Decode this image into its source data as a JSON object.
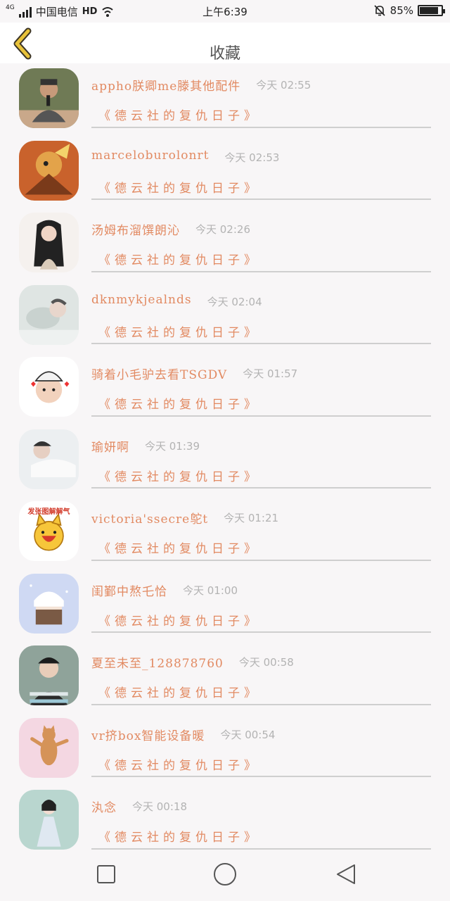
{
  "status": {
    "network": "4G",
    "carrier": "中国电信",
    "hd": "HD",
    "time": "上午6:39",
    "battery": "85%",
    "battery_level": 0.85
  },
  "header": {
    "title": "收藏"
  },
  "items": [
    {
      "name": "appho朕卿me滕其他配件",
      "time": "今天 02:55",
      "subtitle": "《德云社的复仇日子》",
      "avatar": "man-with-microphone"
    },
    {
      "name": "marceloburolonrt",
      "time": "今天 02:53",
      "subtitle": "《德云社的复仇日子》",
      "avatar": "game-warrior-art"
    },
    {
      "name": "汤姆布溜馔朗沁",
      "time": "今天 02:26",
      "subtitle": "《德云社的复仇日子》",
      "avatar": "girl-long-hair"
    },
    {
      "name": "dknmykjealnds",
      "time": "今天 02:04",
      "subtitle": "《德云社的复仇日子》",
      "avatar": "sleeping-person"
    },
    {
      "name": "骑着小毛驴去看TSGDV",
      "time": "今天 01:57",
      "subtitle": "《德云社的复仇日子》",
      "avatar": "baby-with-hat"
    },
    {
      "name": "瑜妍啊",
      "time": "今天 01:39",
      "subtitle": "《德云社的复仇日子》",
      "avatar": "boy-lying-down"
    },
    {
      "name": "victoria'ssecre鸵t",
      "time": "今天 01:21",
      "subtitle": "《德云社的复仇日子》",
      "avatar": "yellow-cartoon-cat",
      "avatar_text": "发张图解解气"
    },
    {
      "name": "闺鄞中熬乇恰",
      "time": "今天 01:00",
      "subtitle": "《德云社的复仇日子》",
      "avatar": "anime-girl-snow"
    },
    {
      "name": "夏至未至_128878760",
      "time": "今天 00:58",
      "subtitle": "《德云社的复仇日子》",
      "avatar": "boy-striped-shirt"
    },
    {
      "name": "vr挤box智能设备暖",
      "time": "今天 00:54",
      "subtitle": "《德云社的复仇日子》",
      "avatar": "dancing-cat"
    },
    {
      "name": "汍念",
      "time": "今天 00:18",
      "subtitle": "《德云社的复仇日子》",
      "avatar": "girl-in-dress"
    }
  ],
  "colors": {
    "accent": "#e28a62",
    "time": "#b3b3b3",
    "back": "#e8c23a"
  }
}
